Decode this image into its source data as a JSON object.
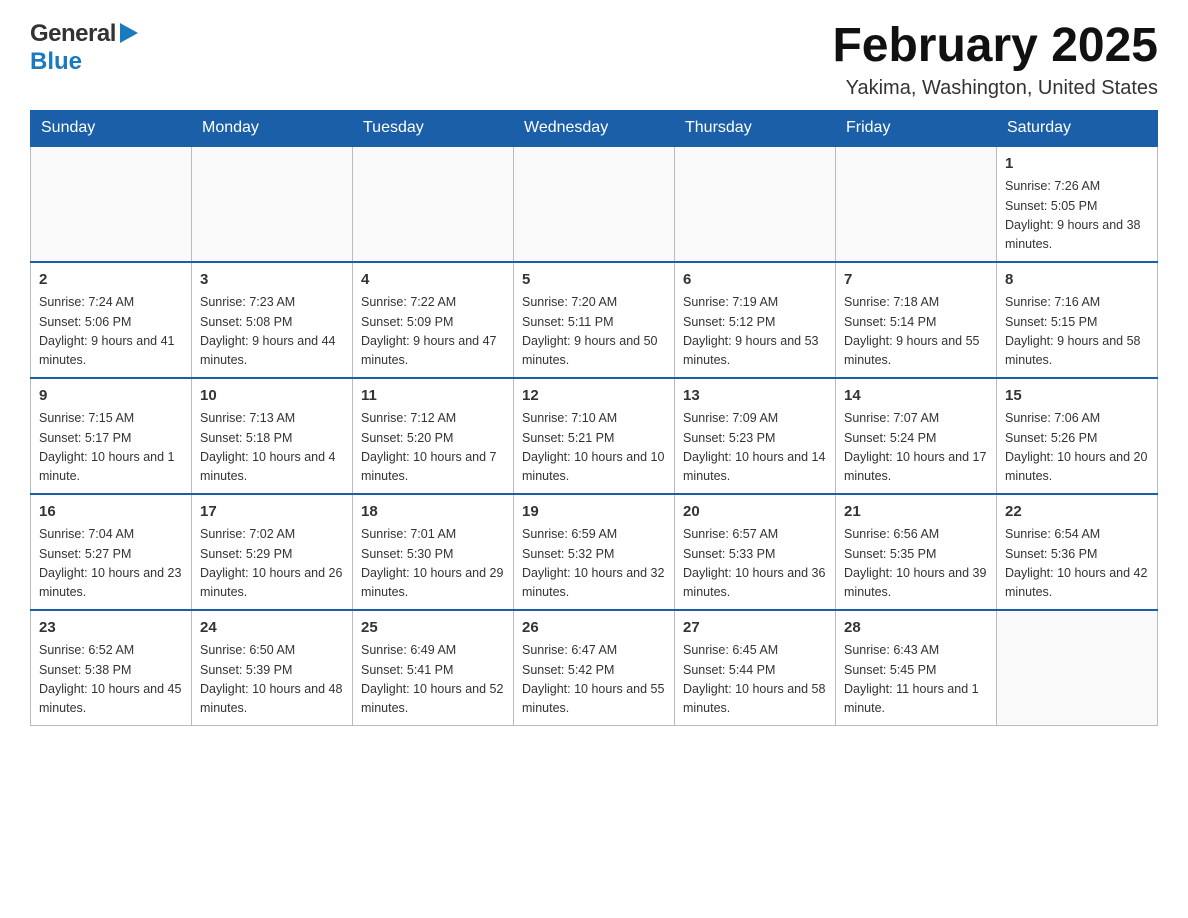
{
  "header": {
    "logo": {
      "general": "General",
      "triangle": "▶",
      "blue": "Blue"
    },
    "title": "February 2025",
    "subtitle": "Yakima, Washington, United States"
  },
  "days_of_week": [
    "Sunday",
    "Monday",
    "Tuesday",
    "Wednesday",
    "Thursday",
    "Friday",
    "Saturday"
  ],
  "weeks": [
    [
      {
        "day": "",
        "info": ""
      },
      {
        "day": "",
        "info": ""
      },
      {
        "day": "",
        "info": ""
      },
      {
        "day": "",
        "info": ""
      },
      {
        "day": "",
        "info": ""
      },
      {
        "day": "",
        "info": ""
      },
      {
        "day": "1",
        "info": "Sunrise: 7:26 AM\nSunset: 5:05 PM\nDaylight: 9 hours and 38 minutes."
      }
    ],
    [
      {
        "day": "2",
        "info": "Sunrise: 7:24 AM\nSunset: 5:06 PM\nDaylight: 9 hours and 41 minutes."
      },
      {
        "day": "3",
        "info": "Sunrise: 7:23 AM\nSunset: 5:08 PM\nDaylight: 9 hours and 44 minutes."
      },
      {
        "day": "4",
        "info": "Sunrise: 7:22 AM\nSunset: 5:09 PM\nDaylight: 9 hours and 47 minutes."
      },
      {
        "day": "5",
        "info": "Sunrise: 7:20 AM\nSunset: 5:11 PM\nDaylight: 9 hours and 50 minutes."
      },
      {
        "day": "6",
        "info": "Sunrise: 7:19 AM\nSunset: 5:12 PM\nDaylight: 9 hours and 53 minutes."
      },
      {
        "day": "7",
        "info": "Sunrise: 7:18 AM\nSunset: 5:14 PM\nDaylight: 9 hours and 55 minutes."
      },
      {
        "day": "8",
        "info": "Sunrise: 7:16 AM\nSunset: 5:15 PM\nDaylight: 9 hours and 58 minutes."
      }
    ],
    [
      {
        "day": "9",
        "info": "Sunrise: 7:15 AM\nSunset: 5:17 PM\nDaylight: 10 hours and 1 minute."
      },
      {
        "day": "10",
        "info": "Sunrise: 7:13 AM\nSunset: 5:18 PM\nDaylight: 10 hours and 4 minutes."
      },
      {
        "day": "11",
        "info": "Sunrise: 7:12 AM\nSunset: 5:20 PM\nDaylight: 10 hours and 7 minutes."
      },
      {
        "day": "12",
        "info": "Sunrise: 7:10 AM\nSunset: 5:21 PM\nDaylight: 10 hours and 10 minutes."
      },
      {
        "day": "13",
        "info": "Sunrise: 7:09 AM\nSunset: 5:23 PM\nDaylight: 10 hours and 14 minutes."
      },
      {
        "day": "14",
        "info": "Sunrise: 7:07 AM\nSunset: 5:24 PM\nDaylight: 10 hours and 17 minutes."
      },
      {
        "day": "15",
        "info": "Sunrise: 7:06 AM\nSunset: 5:26 PM\nDaylight: 10 hours and 20 minutes."
      }
    ],
    [
      {
        "day": "16",
        "info": "Sunrise: 7:04 AM\nSunset: 5:27 PM\nDaylight: 10 hours and 23 minutes."
      },
      {
        "day": "17",
        "info": "Sunrise: 7:02 AM\nSunset: 5:29 PM\nDaylight: 10 hours and 26 minutes."
      },
      {
        "day": "18",
        "info": "Sunrise: 7:01 AM\nSunset: 5:30 PM\nDaylight: 10 hours and 29 minutes."
      },
      {
        "day": "19",
        "info": "Sunrise: 6:59 AM\nSunset: 5:32 PM\nDaylight: 10 hours and 32 minutes."
      },
      {
        "day": "20",
        "info": "Sunrise: 6:57 AM\nSunset: 5:33 PM\nDaylight: 10 hours and 36 minutes."
      },
      {
        "day": "21",
        "info": "Sunrise: 6:56 AM\nSunset: 5:35 PM\nDaylight: 10 hours and 39 minutes."
      },
      {
        "day": "22",
        "info": "Sunrise: 6:54 AM\nSunset: 5:36 PM\nDaylight: 10 hours and 42 minutes."
      }
    ],
    [
      {
        "day": "23",
        "info": "Sunrise: 6:52 AM\nSunset: 5:38 PM\nDaylight: 10 hours and 45 minutes."
      },
      {
        "day": "24",
        "info": "Sunrise: 6:50 AM\nSunset: 5:39 PM\nDaylight: 10 hours and 48 minutes."
      },
      {
        "day": "25",
        "info": "Sunrise: 6:49 AM\nSunset: 5:41 PM\nDaylight: 10 hours and 52 minutes."
      },
      {
        "day": "26",
        "info": "Sunrise: 6:47 AM\nSunset: 5:42 PM\nDaylight: 10 hours and 55 minutes."
      },
      {
        "day": "27",
        "info": "Sunrise: 6:45 AM\nSunset: 5:44 PM\nDaylight: 10 hours and 58 minutes."
      },
      {
        "day": "28",
        "info": "Sunrise: 6:43 AM\nSunset: 5:45 PM\nDaylight: 11 hours and 1 minute."
      },
      {
        "day": "",
        "info": ""
      }
    ]
  ]
}
